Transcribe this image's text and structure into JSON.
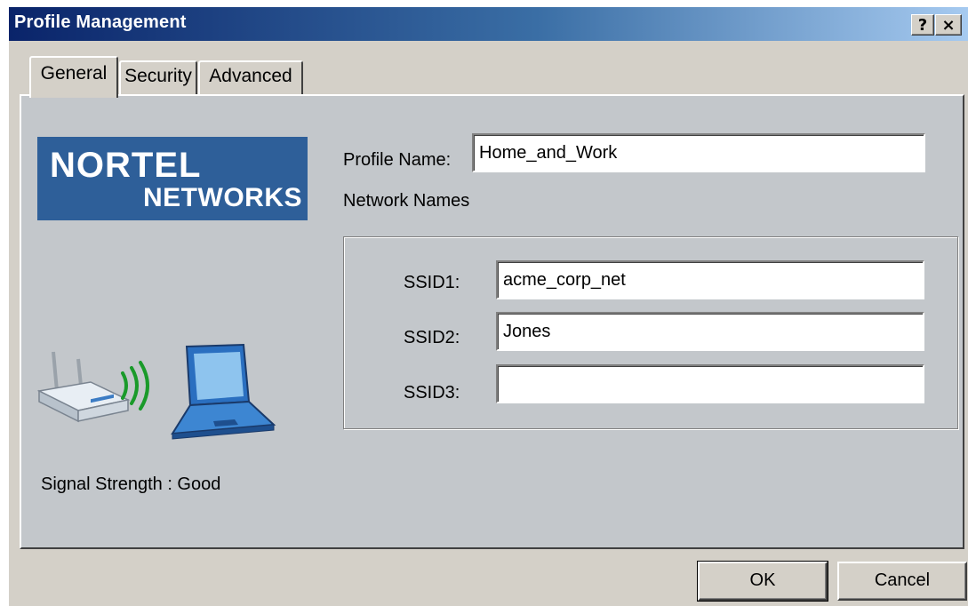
{
  "window": {
    "title": "Profile Management",
    "help_glyph": "?",
    "close_glyph": "×"
  },
  "tabs": [
    {
      "label": "General",
      "selected": true
    },
    {
      "label": "Security",
      "selected": false
    },
    {
      "label": "Advanced",
      "selected": false
    }
  ],
  "logo": {
    "line1": "NORTEL",
    "line2": "NETWORKS",
    "color": "#2e5f99"
  },
  "general": {
    "profile_name_label": "Profile Name:",
    "profile_name_value": "Home_and_Work",
    "network_names_label": "Network Names",
    "ssids": [
      {
        "label": "SSID1:",
        "value": "acme_corp_net"
      },
      {
        "label": "SSID2:",
        "value": "Jones"
      },
      {
        "label": "SSID3:",
        "value": ""
      }
    ],
    "signal_strength": "Signal Strength :  Good"
  },
  "graphic": {
    "icons": [
      "wireless-router-icon",
      "signal-waves-icon",
      "laptop-icon"
    ]
  },
  "buttons": {
    "ok": "OK",
    "cancel": "Cancel"
  },
  "colors": {
    "titlebar_start": "#0a246a",
    "titlebar_end": "#a6caf0",
    "dialog_bg": "#d4d0c8",
    "panel_bg": "#c3c7cb"
  }
}
